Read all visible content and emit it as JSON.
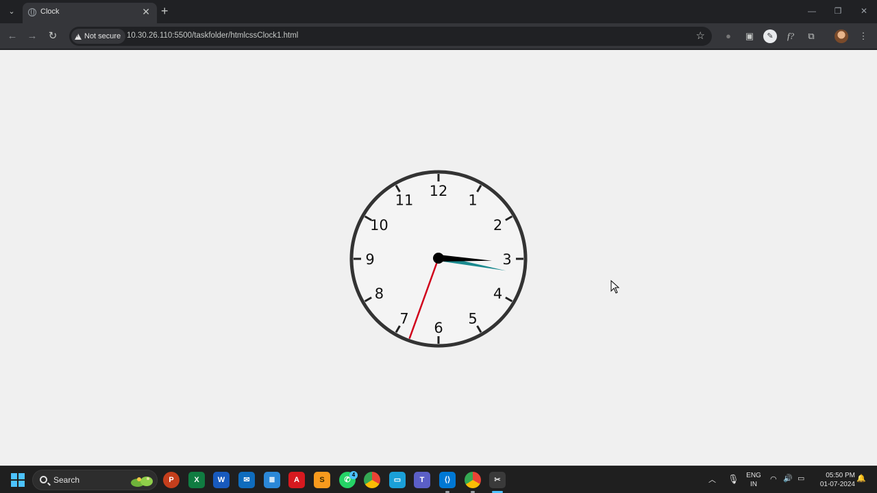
{
  "browser": {
    "tab_title": "Clock",
    "new_tab_symbol": "+",
    "close_symbol": "✕",
    "security_label": "Not secure",
    "url": "10.30.26.110:5500/taskfolder/htmlcssClock1.html"
  },
  "clock": {
    "numbers": [
      "12",
      "1",
      "2",
      "3",
      "4",
      "5",
      "6",
      "7",
      "8",
      "9",
      "10",
      "11"
    ],
    "hour_hand_color": "#000000",
    "minute_hand_color": "#1b8a8f",
    "second_hand_color": "#d0021b",
    "hour_hand_angle_deg": 92,
    "minute_hand_angle_deg": 100,
    "second_hand_angle_deg": 200
  },
  "taskbar": {
    "search_label": "Search",
    "whatsapp_badge": "4",
    "language": "ENG",
    "region": "IN",
    "time": "05:50 PM",
    "date": "01-07-2024",
    "accent_color": "#4cc2ff"
  }
}
